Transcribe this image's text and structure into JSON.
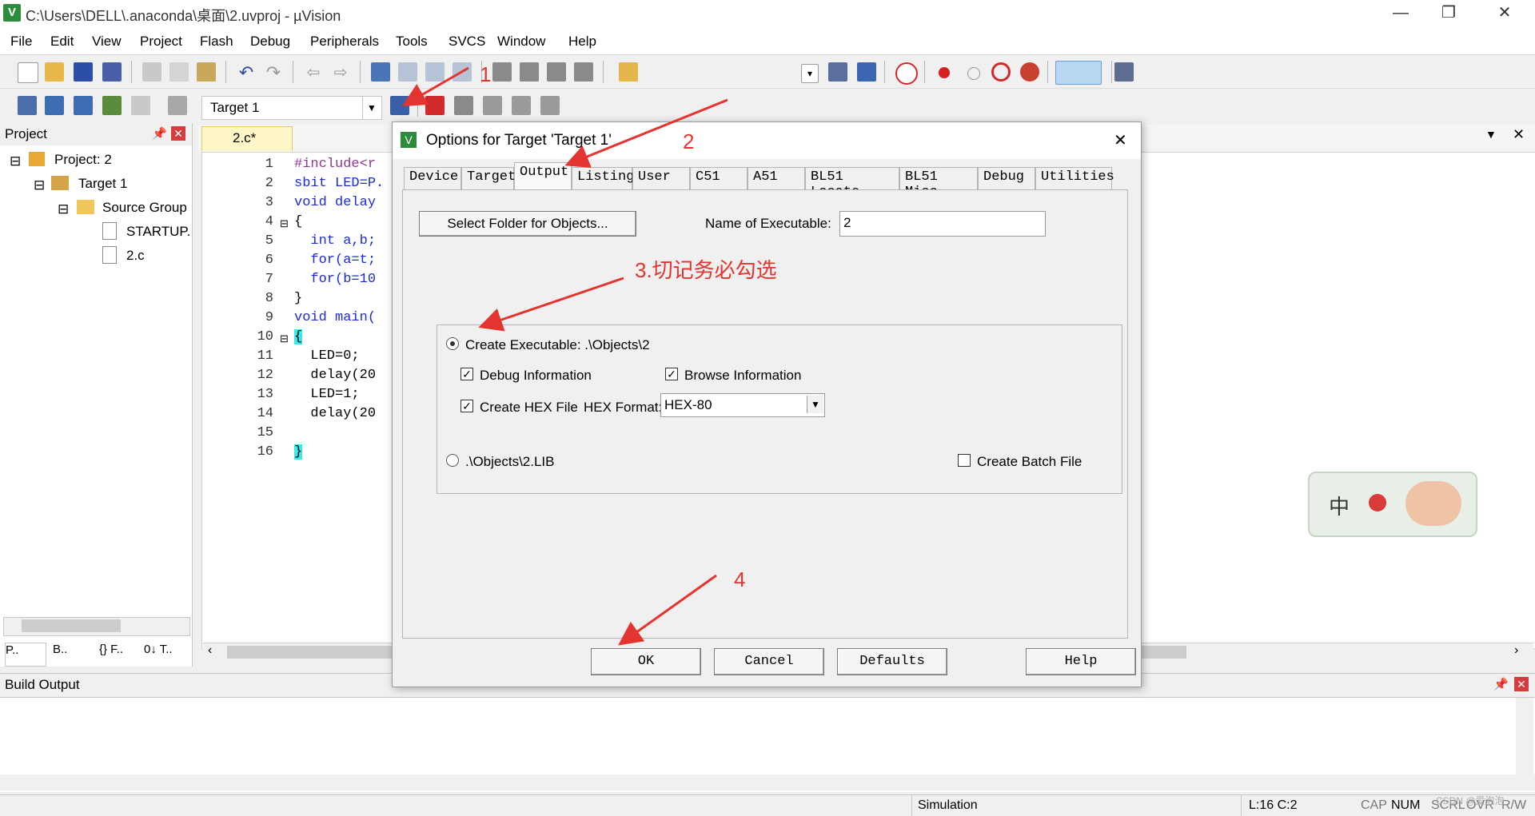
{
  "window": {
    "title": "C:\\Users\\DELL\\.anaconda\\桌面\\2.uvproj - µVision",
    "app_icon": "V",
    "controls": [
      "—",
      "❐",
      "✕"
    ]
  },
  "menu": [
    "File",
    "Edit",
    "View",
    "Project",
    "Flash",
    "Debug",
    "Peripherals",
    "Tools",
    "SVCS",
    "Window",
    "Help"
  ],
  "toolbar2": {
    "target": "Target 1"
  },
  "project_panel": {
    "title": "Project",
    "tree": [
      "Project: 2",
      "Target 1",
      "Source Group",
      "STARTUP.",
      "2.c"
    ],
    "bottom_tabs": [
      "P..",
      "B..",
      "{} F..",
      "0↓ T.."
    ]
  },
  "editor": {
    "tab": "2.c*",
    "line_numbers": [
      "1",
      "2",
      "3",
      "4",
      "5",
      "6",
      "7",
      "8",
      "9",
      "10",
      "11",
      "12",
      "13",
      "14",
      "15",
      "16"
    ],
    "lines": [
      "#include<r",
      "sbit LED=P.",
      "void delay",
      "{",
      "  int a,b;",
      "  for(a=t;",
      "  for(b=10",
      "}",
      "void main(",
      "{",
      "  LED=0;",
      "  delay(20",
      "  LED=1;",
      "  delay(20",
      "",
      "}"
    ]
  },
  "dialog": {
    "title": "Options for Target 'Target 1'",
    "close": "✕",
    "tabs": [
      "Device",
      "Target",
      "Output",
      "Listing",
      "User",
      "C51",
      "A51",
      "BL51 Locate",
      "BL51 Misc",
      "Debug",
      "Utilities"
    ],
    "active_tab": "Output",
    "select_folder_button": "Select Folder for Objects...",
    "name_label": "Name of Executable:",
    "name_value": "2",
    "create_executable_label": "Create Executable:  .\\Objects\\2",
    "debug_info_label": "Debug Information",
    "browse_info_label": "Browse Information",
    "create_hex_label": "Create HEX File",
    "hex_format_label": "HEX Format:",
    "hex_format_value": "HEX-80",
    "lib_label": ".\\Objects\\2.LIB",
    "batch_label": "Create Batch File",
    "buttons": {
      "ok": "OK",
      "cancel": "Cancel",
      "defaults": "Defaults",
      "help": "Help"
    }
  },
  "build_output": {
    "title": "Build Output"
  },
  "status_bar": {
    "mode": "Simulation",
    "position": "L:16 C:2",
    "cap": "CAP",
    "num": "NUM",
    "scrl": "SCRL",
    "ovr": "OVR",
    "rw": "R/W"
  },
  "annotations": {
    "a1": "1",
    "a2": "2",
    "a3": "3.切记务必勾选",
    "a4": "4"
  },
  "ime": {
    "label": "中"
  },
  "watermark": "CSDN @爱泡泡",
  "colors": {
    "annotation": "#e3342f",
    "keyword": "#1a2bd6",
    "tab_yellow": "#fff6c8"
  }
}
